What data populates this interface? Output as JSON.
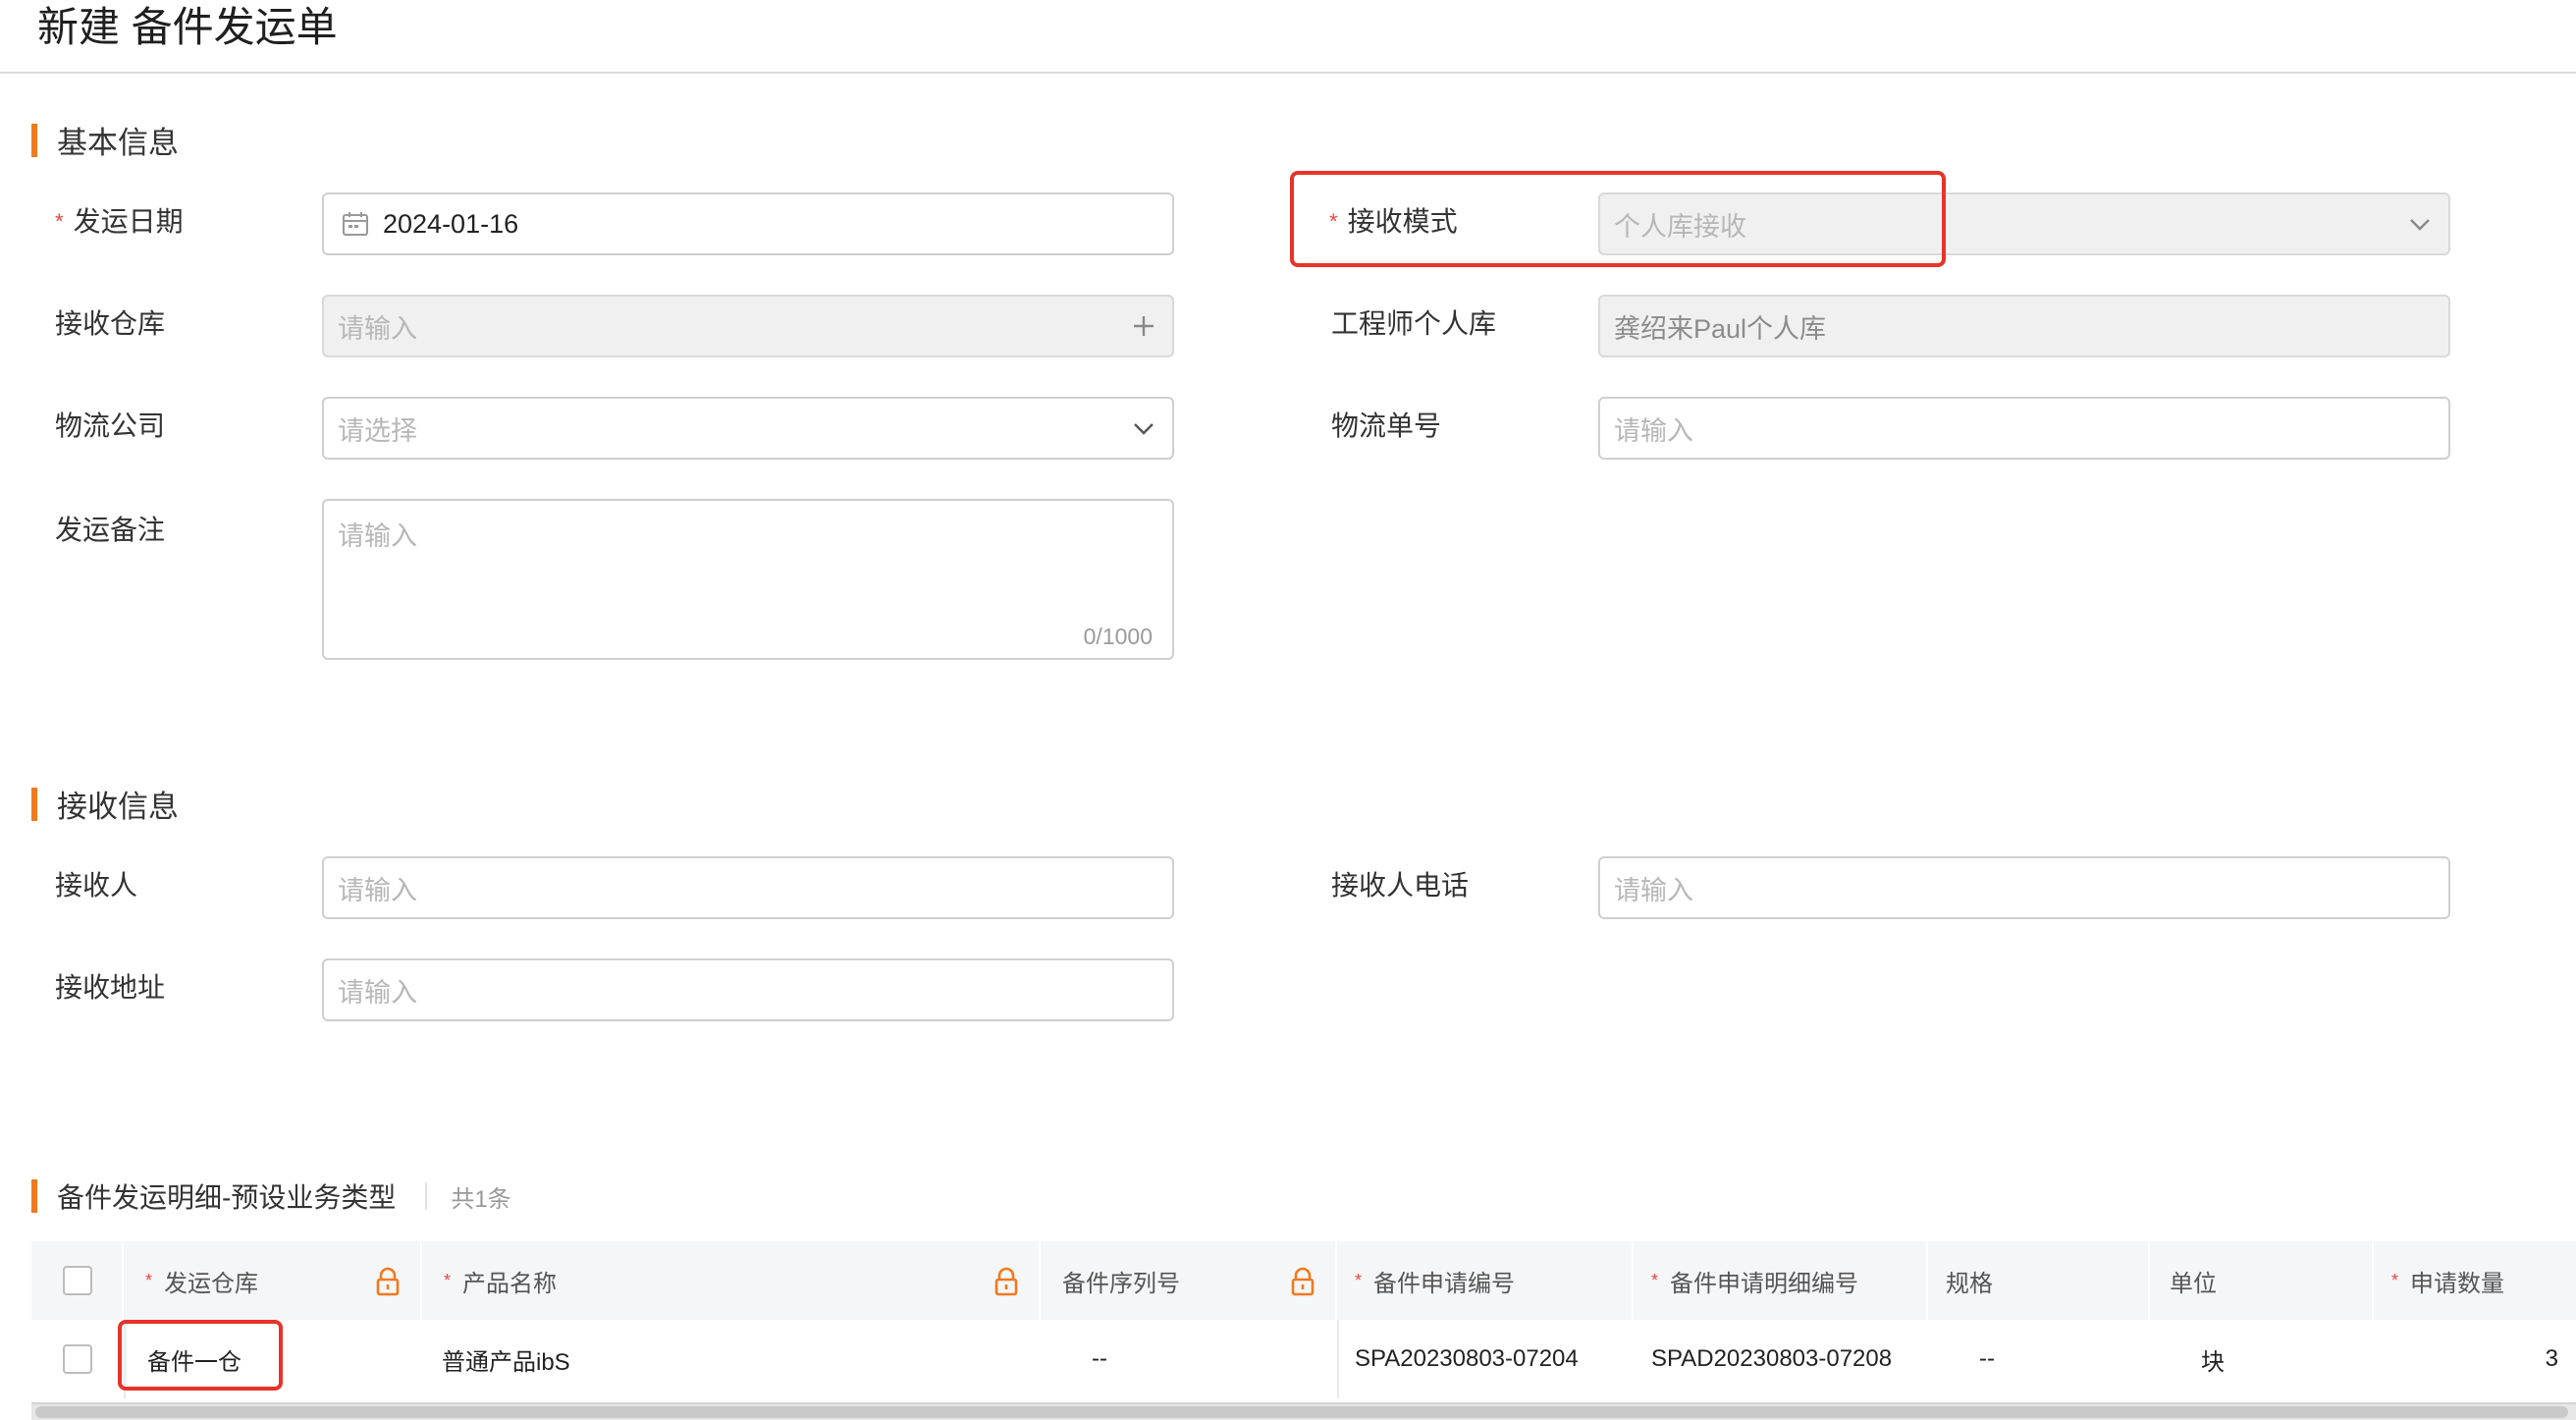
{
  "page": {
    "title": "新建 备件发运单"
  },
  "sections": {
    "basic": "基本信息",
    "receive": "接收信息",
    "detail": "备件发运明细-预设业务类型",
    "detail_count": "共1条"
  },
  "form": {
    "ship_date": {
      "label": "发运日期",
      "value": "2024-01-16"
    },
    "receive_mode": {
      "label": "接收模式",
      "value": "个人库接收"
    },
    "receive_warehouse": {
      "label": "接收仓库",
      "placeholder": "请输入"
    },
    "engineer_warehouse": {
      "label": "工程师个人库",
      "value": "龚绍来Paul个人库"
    },
    "logistics_company": {
      "label": "物流公司",
      "placeholder": "请选择"
    },
    "tracking_no": {
      "label": "物流单号",
      "placeholder": "请输入"
    },
    "remark": {
      "label": "发运备注",
      "placeholder": "请输入",
      "counter": "0/1000"
    },
    "receiver": {
      "label": "接收人",
      "placeholder": "请输入"
    },
    "receiver_phone": {
      "label": "接收人电话",
      "placeholder": "请输入"
    },
    "receiver_address": {
      "label": "接收地址",
      "placeholder": "请输入"
    }
  },
  "table": {
    "columns": [
      "发运仓库",
      "产品名称",
      "备件序列号",
      "备件申请编号",
      "备件申请明细编号",
      "规格",
      "单位",
      "申请数量"
    ],
    "rows": [
      {
        "warehouse": "备件一仓",
        "product": "普通产品ibS",
        "serial": "--",
        "apply_no": "SPA20230803-07204",
        "detail_no": "SPAD20230803-07208",
        "spec": "--",
        "unit": "块",
        "qty": "3"
      }
    ]
  },
  "colors": {
    "accent": "#f07a1e",
    "required": "#e8473e",
    "highlight": "#e8332a"
  },
  "icons": [
    "calendar-icon",
    "chevron-down-icon",
    "plus-icon",
    "lock-icon"
  ]
}
